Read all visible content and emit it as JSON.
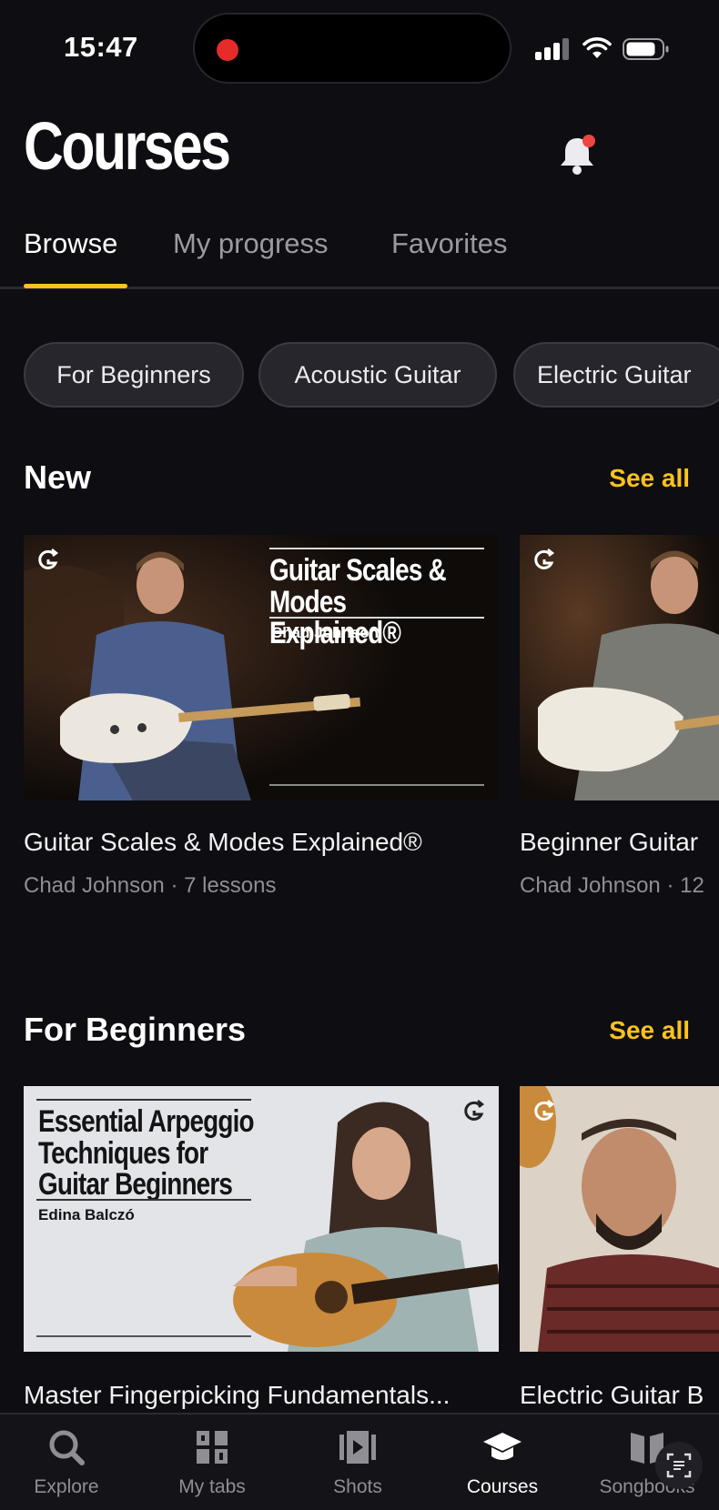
{
  "status_bar": {
    "time": "15:47"
  },
  "header": {
    "title": "Courses"
  },
  "tabs": [
    {
      "label": "Browse",
      "active": true
    },
    {
      "label": "My progress",
      "active": false
    },
    {
      "label": "Favorites",
      "active": false
    }
  ],
  "chips": [
    {
      "label": "For Beginners"
    },
    {
      "label": "Acoustic Guitar"
    },
    {
      "label": "Electric Guitar"
    }
  ],
  "sections": {
    "new": {
      "title": "New",
      "see_all": "See all",
      "cards": [
        {
          "title": "Guitar Scales & Modes Explained®",
          "meta": "Chad Johnson · 7 lessons",
          "thumb_title_lines": [
            "Guitar Scales &",
            "Modes Explained®"
          ],
          "thumb_author": "Chad Johnson"
        },
        {
          "title": "Beginner Guitar",
          "meta": "Chad Johnson · 12"
        }
      ]
    },
    "beginners": {
      "title": "For Beginners",
      "see_all": "See all",
      "cards": [
        {
          "title": "Master Fingerpicking Fundamentals...",
          "thumb_title_lines": [
            "Essential Arpeggio",
            "Techniques for",
            "Guitar Beginners"
          ],
          "thumb_author": "Edina Balczó"
        },
        {
          "title": "Electric Guitar B"
        }
      ]
    }
  },
  "bottom_nav": [
    {
      "label": "Explore",
      "icon": "search-icon",
      "active": false
    },
    {
      "label": "My tabs",
      "icon": "tabs-grid-icon",
      "active": false
    },
    {
      "label": "Shots",
      "icon": "play-shots-icon",
      "active": false
    },
    {
      "label": "Courses",
      "icon": "graduation-cap-icon",
      "active": true
    },
    {
      "label": "Songbooks",
      "icon": "book-open-icon",
      "active": false
    }
  ],
  "colors": {
    "background": "#0d0d12",
    "accent": "#ffc21a",
    "notification": "#ef4444",
    "recording": "#e62b2b"
  }
}
